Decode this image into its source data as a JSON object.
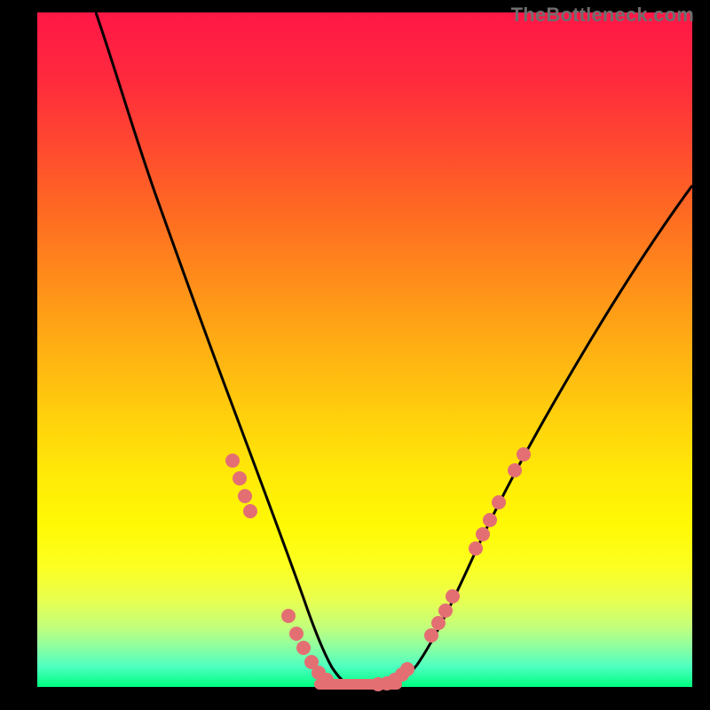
{
  "watermark": "TheBottleneck.com",
  "colors": {
    "curve_stroke": "#000000",
    "marker_fill": "#e46f73",
    "marker_stroke": "#e46f73",
    "flat_segment_stroke": "#e46f73"
  },
  "chart_data": {
    "type": "line",
    "title": "",
    "xlabel": "",
    "ylabel": "",
    "xlim": [
      0,
      100
    ],
    "ylim": [
      0,
      100
    ],
    "grid": false,
    "legend": false,
    "annotations": [
      "TheBottleneck.com"
    ],
    "series": [
      {
        "name": "bottleneck-curve",
        "x": [
          9,
          13,
          17,
          21,
          24,
          27,
          29,
          31,
          33,
          35,
          37,
          38.5,
          40,
          41.5,
          43,
          46,
          50,
          55,
          60,
          65,
          70,
          75,
          80,
          85,
          90,
          95,
          100
        ],
        "y": [
          100,
          86,
          74,
          62,
          52,
          42,
          34,
          27,
          21,
          15,
          10,
          6.5,
          3.5,
          1.5,
          0.5,
          0,
          0,
          0.5,
          3,
          8,
          14,
          21,
          29,
          37,
          45,
          53,
          61
        ]
      }
    ],
    "markers": {
      "name": "highlight-points",
      "x_approx": [
        30,
        31,
        32,
        32.5,
        38,
        39,
        40,
        41,
        42,
        43,
        50,
        51.5,
        52.5,
        53.5,
        55,
        60,
        61,
        62,
        63
      ],
      "y_approx": [
        30,
        27,
        24,
        22,
        6,
        5,
        3,
        2,
        1.2,
        0.6,
        0,
        0.2,
        0.6,
        1.4,
        1.8,
        3.2,
        4.2,
        5.8,
        8.5
      ]
    },
    "flat_minimum_segment": {
      "x_start": 43,
      "x_end": 55,
      "y": 0
    }
  }
}
